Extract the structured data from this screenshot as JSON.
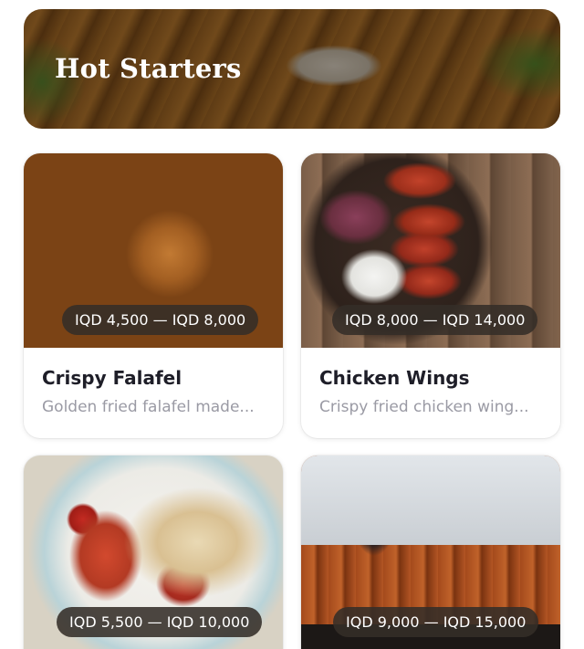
{
  "section": {
    "title": "Hot Starters"
  },
  "items": [
    {
      "name": "Crispy Falafel",
      "description": "Golden fried falafel made...",
      "price": "IQD 4,500 — IQD 8,000",
      "image_icon": "falafel-photo"
    },
    {
      "name": "Chicken Wings",
      "description": "Crispy fried chicken wing...",
      "price": "IQD 8,000 — IQD 14,000",
      "image_icon": "chicken-wings-photo"
    },
    {
      "name": "",
      "description": "",
      "price": "IQD 5,500 — IQD 10,000",
      "image_icon": "lasagna-photo"
    },
    {
      "name": "",
      "description": "",
      "price": "IQD 9,000 — IQD 15,000",
      "image_icon": "kebab-photo"
    }
  ],
  "colors": {
    "price_pill_bg": "#342e28",
    "title_text": "#1e1e28",
    "description_text": "#9a9aa4"
  }
}
